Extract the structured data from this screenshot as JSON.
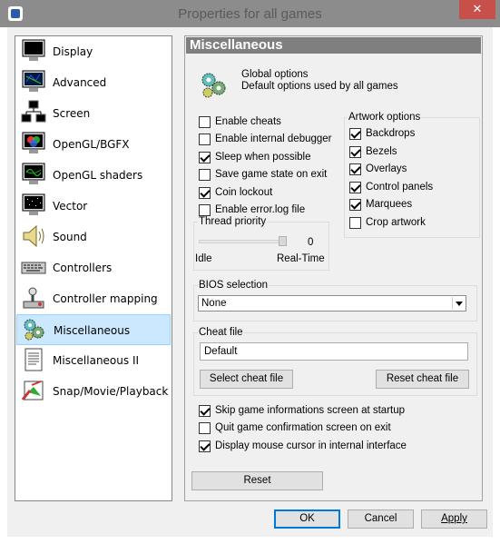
{
  "window": {
    "title": "Properties for all games",
    "close_glyph": "✕"
  },
  "sidebar": {
    "items": [
      {
        "label": "Display",
        "icon": "monitor-icon"
      },
      {
        "label": "Advanced",
        "icon": "advanced-display-icon"
      },
      {
        "label": "Screen",
        "icon": "network-screens-icon"
      },
      {
        "label": "OpenGL/BGFX",
        "icon": "opengl-bgfx-icon"
      },
      {
        "label": "OpenGL shaders",
        "icon": "shaders-icon"
      },
      {
        "label": "Vector",
        "icon": "vector-icon"
      },
      {
        "label": "Sound",
        "icon": "speaker-icon"
      },
      {
        "label": "Controllers",
        "icon": "keyboard-icon"
      },
      {
        "label": "Controller mapping",
        "icon": "joystick-icon"
      },
      {
        "label": "Miscellaneous",
        "icon": "misc-gears-icon"
      },
      {
        "label": "Miscellaneous II",
        "icon": "document-icon"
      },
      {
        "label": "Snap/Movie/Playback",
        "icon": "snapshot-icon"
      }
    ],
    "selected_index": 9
  },
  "panel": {
    "header": "Miscellaneous",
    "global_title": "Global options",
    "global_subtitle": "Default options used by all games",
    "options": [
      {
        "label": "Enable cheats",
        "checked": false
      },
      {
        "label": "Enable internal debugger",
        "checked": false
      },
      {
        "label": "Sleep when possible",
        "checked": true
      },
      {
        "label": "Save game state on exit",
        "checked": false
      },
      {
        "label": "Coin lockout",
        "checked": true
      },
      {
        "label": "Enable error.log file",
        "checked": false
      }
    ],
    "artwork": {
      "title": "Artwork options",
      "items": [
        {
          "label": "Backdrops",
          "checked": true
        },
        {
          "label": "Bezels",
          "checked": true
        },
        {
          "label": "Overlays",
          "checked": true
        },
        {
          "label": "Control panels",
          "checked": true
        },
        {
          "label": "Marquees",
          "checked": true
        },
        {
          "label": "Crop artwork",
          "checked": false
        }
      ]
    },
    "thread_priority": {
      "title": "Thread priority",
      "value": "0",
      "min_label": "Idle",
      "max_label": "Real-Time"
    },
    "bios": {
      "title": "BIOS selection",
      "selected": "None"
    },
    "cheat": {
      "title": "Cheat file",
      "value": "Default",
      "select_button": "Select cheat file",
      "reset_button": "Reset cheat file"
    },
    "bottom_options": [
      {
        "label": "Skip game informations screen at startup",
        "checked": true
      },
      {
        "label": "Quit game confirmation screen on exit",
        "checked": false
      },
      {
        "label": "Display mouse cursor in internal interface",
        "checked": true
      }
    ],
    "reset_button": "Reset"
  },
  "footer": {
    "ok": "OK",
    "cancel": "Cancel",
    "apply": "Apply"
  }
}
